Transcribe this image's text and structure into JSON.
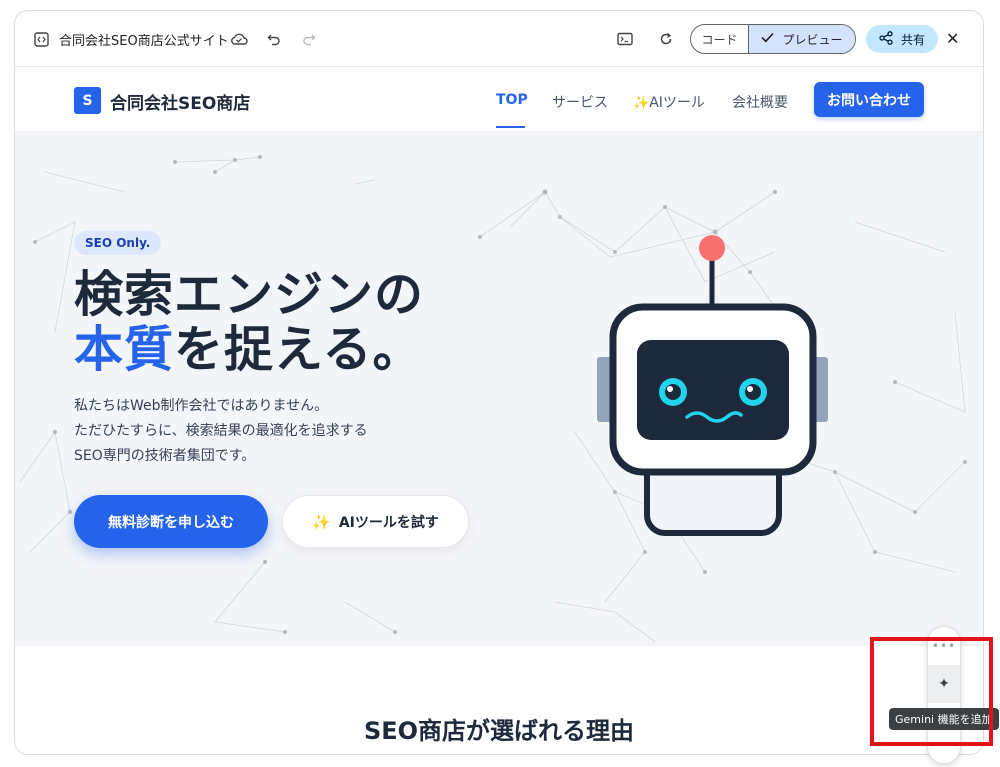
{
  "toolbar": {
    "title": "合同会社SEO商店公式サイト",
    "code_label": "コード",
    "preview_label": "プレビュー",
    "share_label": "共有",
    "icons": [
      "code-file-icon",
      "cloud-save-icon",
      "undo-icon",
      "redo-icon",
      "terminal-icon",
      "refresh-icon",
      "check-icon",
      "share-icon",
      "close-icon"
    ]
  },
  "site": {
    "logo_letter": "S",
    "logo_name": "合同会社SEO商店",
    "nav": [
      {
        "label": "TOP",
        "active": true
      },
      {
        "label": "サービス",
        "active": false
      },
      {
        "label": "AIツール",
        "active": false
      },
      {
        "label": "会社概要",
        "active": false
      }
    ],
    "contact_label": "お問い合わせ",
    "brand_color": "#2563eb"
  },
  "hero": {
    "badge": "SEO Only.",
    "headline_line1": "検索エンジンの",
    "headline_accent": "本質",
    "headline_rest": "を捉える。",
    "lead_lines": [
      "私たちはWeb制作会社ではありません。",
      "ただひたすらに、検索結果の最適化を追求する",
      "SEO専門の技術者集団です。"
    ],
    "primary_cta": "無料診断を申し込む",
    "secondary_cta": "AIツールを試す"
  },
  "section_title": "SEO商店が選ばれる理由",
  "widget": {
    "dots": "•••",
    "tooltip": "Gemini 機能を追加"
  }
}
